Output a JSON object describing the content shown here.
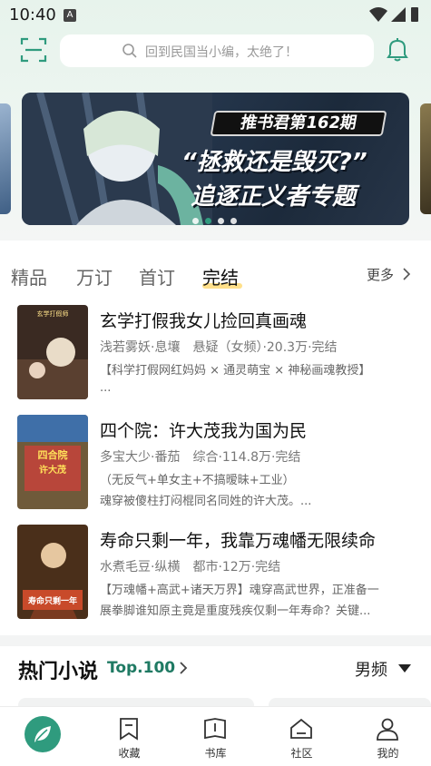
{
  "status_bar": {
    "time": "10:40",
    "badge": "A"
  },
  "header": {
    "search_placeholder": "回到民国当小编，太绝了！",
    "scan_icon": "scan-icon",
    "bell_icon": "bell-icon"
  },
  "banner": {
    "badge": "推书君第162期",
    "line1": "“拯救还是毁灭?”",
    "line2": "追逐正义者专题",
    "dots": 4,
    "active_dot": 1
  },
  "tabs": {
    "items": [
      "精品",
      "万订",
      "首订",
      "完结"
    ],
    "active": "完结",
    "more": "更多"
  },
  "books": [
    {
      "title": "玄学打假我女儿捡回真画魂",
      "meta": "浅若雾妖·息壤　悬疑（女频）·20.3万·完结",
      "desc1": "【科学打假网红妈妈 × 通灵萌宝 × 神秘画魂教授】",
      "desc2": "...",
      "cover_text": "玄学打假师：我女儿捡回真画魂"
    },
    {
      "title": "四个院：许大茂我为国为民",
      "meta": "多宝大少·番茄　综合·114.8万·完结",
      "desc1": "（无反气+单女主+不搞暧昧+工业）",
      "desc2": "魂穿被傻柱打闷棍同名同姓的许大茂。...",
      "cover_text": "四合院：许大茂我为国为民"
    },
    {
      "title": "寿命只剩一年，我靠万魂幡无限续命",
      "meta": "水煮毛豆·纵横　都市·12万·完结",
      "desc1": "【万魂幡+高武+诸天万界】魂穿高武世界，正准备一",
      "desc2": "展拳脚谁知原主竟是重度残疾仅剩一年寿命？关键...",
      "cover_text": "寿命只剩一年"
    }
  ],
  "hot": {
    "title": "热门小说",
    "top": "Top.100",
    "gender": "男频"
  },
  "bottom_nav": [
    {
      "label": "",
      "icon": "home-leaf-icon"
    },
    {
      "label": "收藏",
      "icon": "bookmark-icon"
    },
    {
      "label": "书库",
      "icon": "library-icon"
    },
    {
      "label": "社区",
      "icon": "community-icon"
    },
    {
      "label": "我的",
      "icon": "profile-icon"
    }
  ],
  "colors": {
    "accent": "#2f9b7e",
    "top_green": "#1f7a63",
    "tab_highlight": "#ffe08a"
  }
}
